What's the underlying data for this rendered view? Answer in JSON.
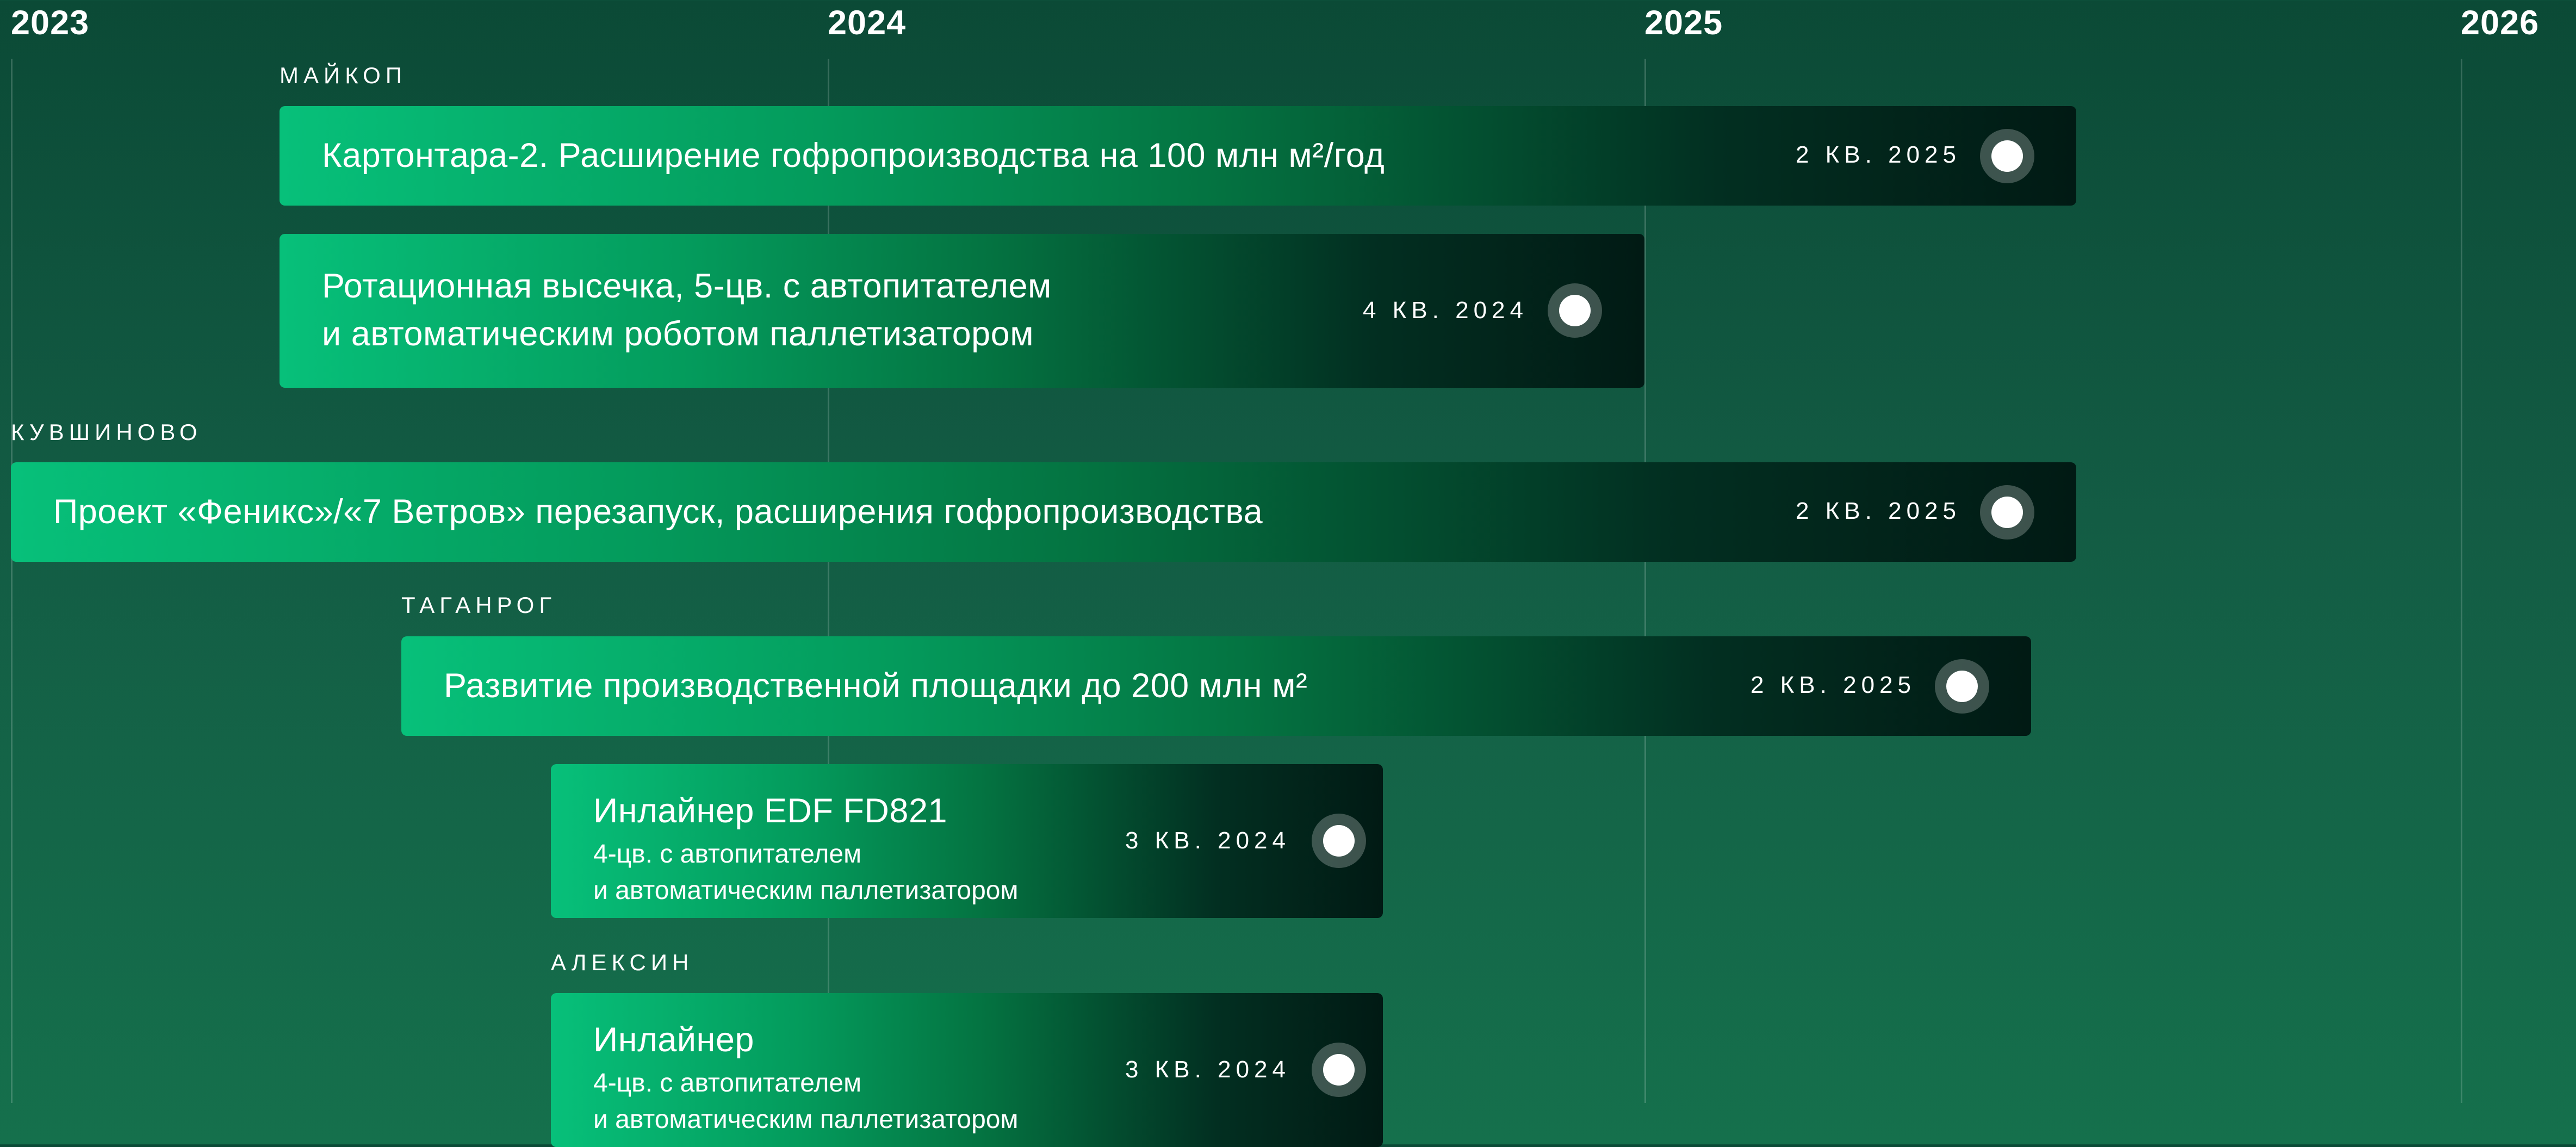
{
  "timeline": {
    "years": [
      "2023",
      "2024",
      "2025",
      "2026"
    ]
  },
  "groups": {
    "maykop": "МАЙКОП",
    "kuvshinovo": "КУВШИНОВО",
    "taganrog": "ТАГАНРОГ",
    "aleksin": "АЛЕКСИН"
  },
  "projects": [
    {
      "title": "Картонтара-2. Расширение гофропроизводства на 100 млн м²/год",
      "quarter": "2 КВ. 2025"
    },
    {
      "title_line1": "Ротационная высечка, 5-цв. с автопитателем",
      "title_line2": "и автоматическим роботом паллетизатором",
      "quarter": "4 КВ. 2024"
    },
    {
      "title": "Проект «Феникс»/«7 Ветров» перезапуск, расширения гофропроизводства",
      "quarter": "2 КВ. 2025"
    },
    {
      "title": "Развитие производственной площадки до 200 млн м²",
      "quarter": "2 КВ. 2025"
    },
    {
      "title": "Инлайнер EDF FD821",
      "sub_line1": "4-цв. с автопитателем",
      "sub_line2": "и автоматическим паллетизатором",
      "quarter": "3 КВ. 2024"
    },
    {
      "title": "Инлайнер",
      "sub_line1": "4-цв. с автопитателем",
      "sub_line2": "и автоматическим паллетизатором",
      "quarter": "3 КВ. 2024"
    }
  ]
}
